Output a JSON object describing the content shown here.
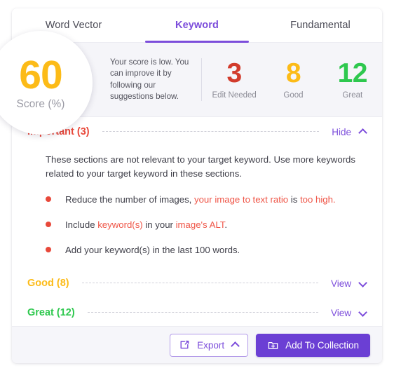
{
  "tabs": [
    {
      "label": "Word Vector",
      "active": false
    },
    {
      "label": "Keyword",
      "active": true
    },
    {
      "label": "Fundamental",
      "active": false
    }
  ],
  "score": {
    "value": "60",
    "label": "Score (%)"
  },
  "summary": {
    "note": "Your score is low. You can improve it by following our suggestions below.",
    "stats": [
      {
        "value": "3",
        "label": "Edit Needed",
        "color": "#d23b2c"
      },
      {
        "value": "8",
        "label": "Good",
        "color": "#fcbb18"
      },
      {
        "value": "12",
        "label": "Great",
        "color": "#2ec84e"
      }
    ]
  },
  "sections": {
    "important": {
      "title": "Important (3)",
      "action": "Hide",
      "description": "These sections are not relevant to your target keyword. Use more keywords related to your target keyword in these sections.",
      "bullets": [
        {
          "parts": [
            {
              "text": "Reduce the number of images, ",
              "highlight": false
            },
            {
              "text": "your image to text ratio",
              "highlight": true
            },
            {
              "text": " is ",
              "highlight": false
            },
            {
              "text": "too high.",
              "highlight": true
            }
          ]
        },
        {
          "parts": [
            {
              "text": "Include ",
              "highlight": false
            },
            {
              "text": "keyword(s)",
              "highlight": true
            },
            {
              "text": " in your ",
              "highlight": false
            },
            {
              "text": "image's ALT",
              "highlight": true
            },
            {
              "text": ".",
              "highlight": false
            }
          ]
        },
        {
          "parts": [
            {
              "text": "Add your keyword(s) in the last 100 words.",
              "highlight": false
            }
          ]
        }
      ]
    },
    "good": {
      "title": "Good (8)",
      "action": "View"
    },
    "great": {
      "title": "Great (12)",
      "action": "View"
    }
  },
  "footer": {
    "export_label": "Export",
    "add_label": "Add To Collection"
  },
  "colors": {
    "accent_purple": "#7c4ddb",
    "filled_purple": "#6b3fd4",
    "red": "#e8483a",
    "amber": "#fcbb18",
    "green": "#2ec84e"
  }
}
